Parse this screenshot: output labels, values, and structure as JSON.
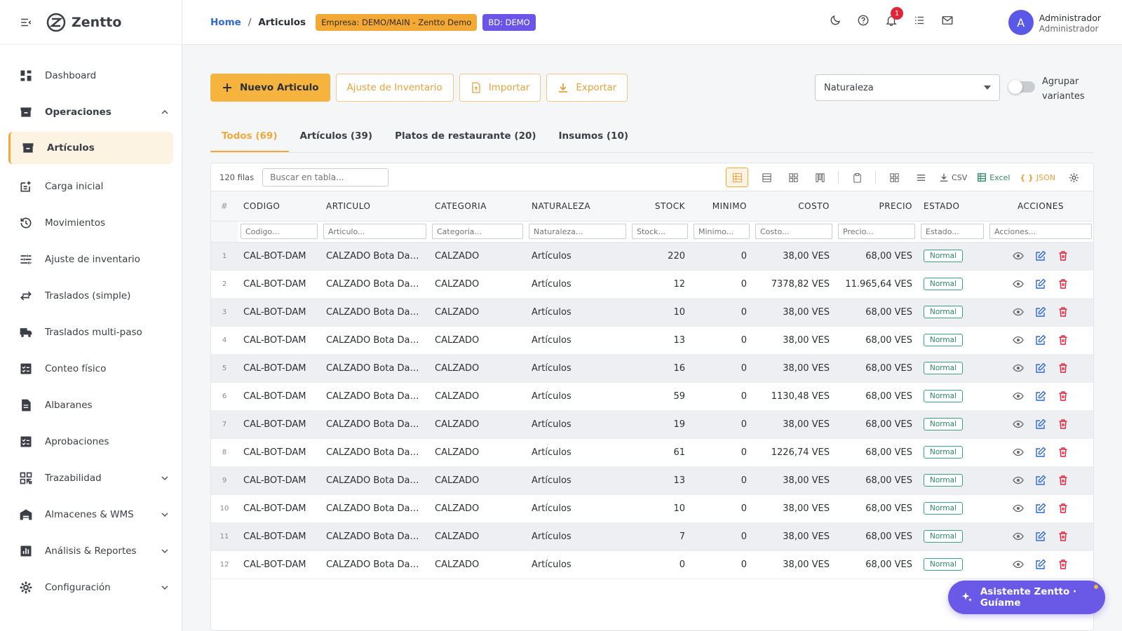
{
  "app": {
    "name": "Zentto"
  },
  "sidebar": {
    "items": [
      {
        "label": "Dashboard",
        "icon": "dashboard-icon"
      },
      {
        "label": "Operaciones",
        "icon": "inventory-box-icon",
        "group": true,
        "expanded": true
      },
      {
        "label": "Artículos",
        "icon": "inventory-box-icon",
        "active": true
      },
      {
        "label": "Carga inicial",
        "icon": "post-add-icon"
      },
      {
        "label": "Movimientos",
        "icon": "history-icon"
      },
      {
        "label": "Ajuste de inventario",
        "icon": "tune-icon"
      },
      {
        "label": "Traslados (simple)",
        "icon": "swap-arrows-icon"
      },
      {
        "label": "Traslados multi-paso",
        "icon": "truck-icon"
      },
      {
        "label": "Conteo físico",
        "icon": "checklist-icon"
      },
      {
        "label": "Albaranes",
        "icon": "document-icon"
      },
      {
        "label": "Aprobaciones",
        "icon": "checklist-icon"
      },
      {
        "label": "Trazabilidad",
        "icon": "qr-code-icon",
        "expandable": true
      },
      {
        "label": "Almacenes & WMS",
        "icon": "warehouse-icon",
        "expandable": true
      },
      {
        "label": "Análisis & Reportes",
        "icon": "bar-chart-icon",
        "expandable": true
      },
      {
        "label": "Configuración",
        "icon": "gear-icon",
        "expandable": true
      }
    ]
  },
  "header": {
    "breadcrumb_home": "Home",
    "breadcrumb_sep": "/",
    "breadcrumb_current": "Articulos",
    "company_chip": "Empresa: DEMO/MAIN - Zentto Demo",
    "db_chip": "BD: DEMO",
    "notifications_count": "1",
    "user_initial": "A",
    "user_name": "Administrador",
    "user_role": "Administrador"
  },
  "toolbar": {
    "new_label": "Nuevo Articulo",
    "adjust_label": "Ajuste de Inventario",
    "import_label": "Importar",
    "export_label": "Exportar",
    "filter_value": "Naturaleza",
    "group_label": "Agrupar variantes",
    "group_enabled": false
  },
  "tabs": [
    {
      "label": "Todos (69)",
      "active": true
    },
    {
      "label": "Artículos (39)"
    },
    {
      "label": "Platos de restaurante (20)"
    },
    {
      "label": "Insumos (10)"
    }
  ],
  "grid": {
    "rows_count": "120 filas",
    "search_placeholder": "Buscar en tabla...",
    "export_csv": "CSV",
    "export_excel": "Excel",
    "export_json": "JSON",
    "columns": [
      "#",
      "CODIGO",
      "ARTICULO",
      "CATEGORIA",
      "NATURALEZA",
      "STOCK",
      "MINIMO",
      "COSTO",
      "PRECIO",
      "ESTADO",
      "ACCIONES"
    ],
    "filters": [
      "Codigo...",
      "Articulo...",
      "Categoria...",
      "Naturaleza...",
      "Stock...",
      "Minimo...",
      "Costo...",
      "Precio...",
      "Estado...",
      "Acciones..."
    ],
    "rows": [
      [
        "1",
        "CAL-BOT-DAM",
        "CALZADO Bota Dama",
        "CALZADO",
        "Artículos",
        "220",
        "0",
        "38,00 VES",
        "68,00 VES",
        "Normal"
      ],
      [
        "2",
        "CAL-BOT-DAM",
        "CALZADO Bota Dama",
        "CALZADO",
        "Artículos",
        "12",
        "0",
        "7378,82 VES",
        "11.965,64 VES",
        "Normal"
      ],
      [
        "3",
        "CAL-BOT-DAM",
        "CALZADO Bota Dama",
        "CALZADO",
        "Artículos",
        "10",
        "0",
        "38,00 VES",
        "68,00 VES",
        "Normal"
      ],
      [
        "4",
        "CAL-BOT-DAM",
        "CALZADO Bota Dama",
        "CALZADO",
        "Artículos",
        "13",
        "0",
        "38,00 VES",
        "68,00 VES",
        "Normal"
      ],
      [
        "5",
        "CAL-BOT-DAM",
        "CALZADO Bota Dama",
        "CALZADO",
        "Artículos",
        "16",
        "0",
        "38,00 VES",
        "68,00 VES",
        "Normal"
      ],
      [
        "6",
        "CAL-BOT-DAM",
        "CALZADO Bota Dama",
        "CALZADO",
        "Artículos",
        "59",
        "0",
        "1130,48 VES",
        "68,00 VES",
        "Normal"
      ],
      [
        "7",
        "CAL-BOT-DAM",
        "CALZADO Bota Dama",
        "CALZADO",
        "Artículos",
        "19",
        "0",
        "38,00 VES",
        "68,00 VES",
        "Normal"
      ],
      [
        "8",
        "CAL-BOT-DAM",
        "CALZADO Bota Dama",
        "CALZADO",
        "Artículos",
        "61",
        "0",
        "1226,74 VES",
        "68,00 VES",
        "Normal"
      ],
      [
        "9",
        "CAL-BOT-DAM",
        "CALZADO Bota Dama",
        "CALZADO",
        "Artículos",
        "13",
        "0",
        "38,00 VES",
        "68,00 VES",
        "Normal"
      ],
      [
        "10",
        "CAL-BOT-DAM",
        "CALZADO Bota Dama",
        "CALZADO",
        "Artículos",
        "10",
        "0",
        "38,00 VES",
        "68,00 VES",
        "Normal"
      ],
      [
        "11",
        "CAL-BOT-DAM",
        "CALZADO Bota Dama",
        "CALZADO",
        "Artículos",
        "7",
        "0",
        "38,00 VES",
        "68,00 VES",
        "Normal"
      ],
      [
        "12",
        "CAL-BOT-DAM",
        "CALZADO Bota Dama",
        "CALZADO",
        "Artículos",
        "0",
        "0",
        "38,00 VES",
        "68,00 VES",
        "Normal"
      ]
    ]
  },
  "assistant": {
    "label": "Asistente Zentto · Guíame"
  },
  "colors": {
    "accent": "#f6b43f",
    "brand_purple": "#6a58e6",
    "link": "#2f6ad1",
    "danger": "#e0253b",
    "success": "#2e8a63"
  }
}
